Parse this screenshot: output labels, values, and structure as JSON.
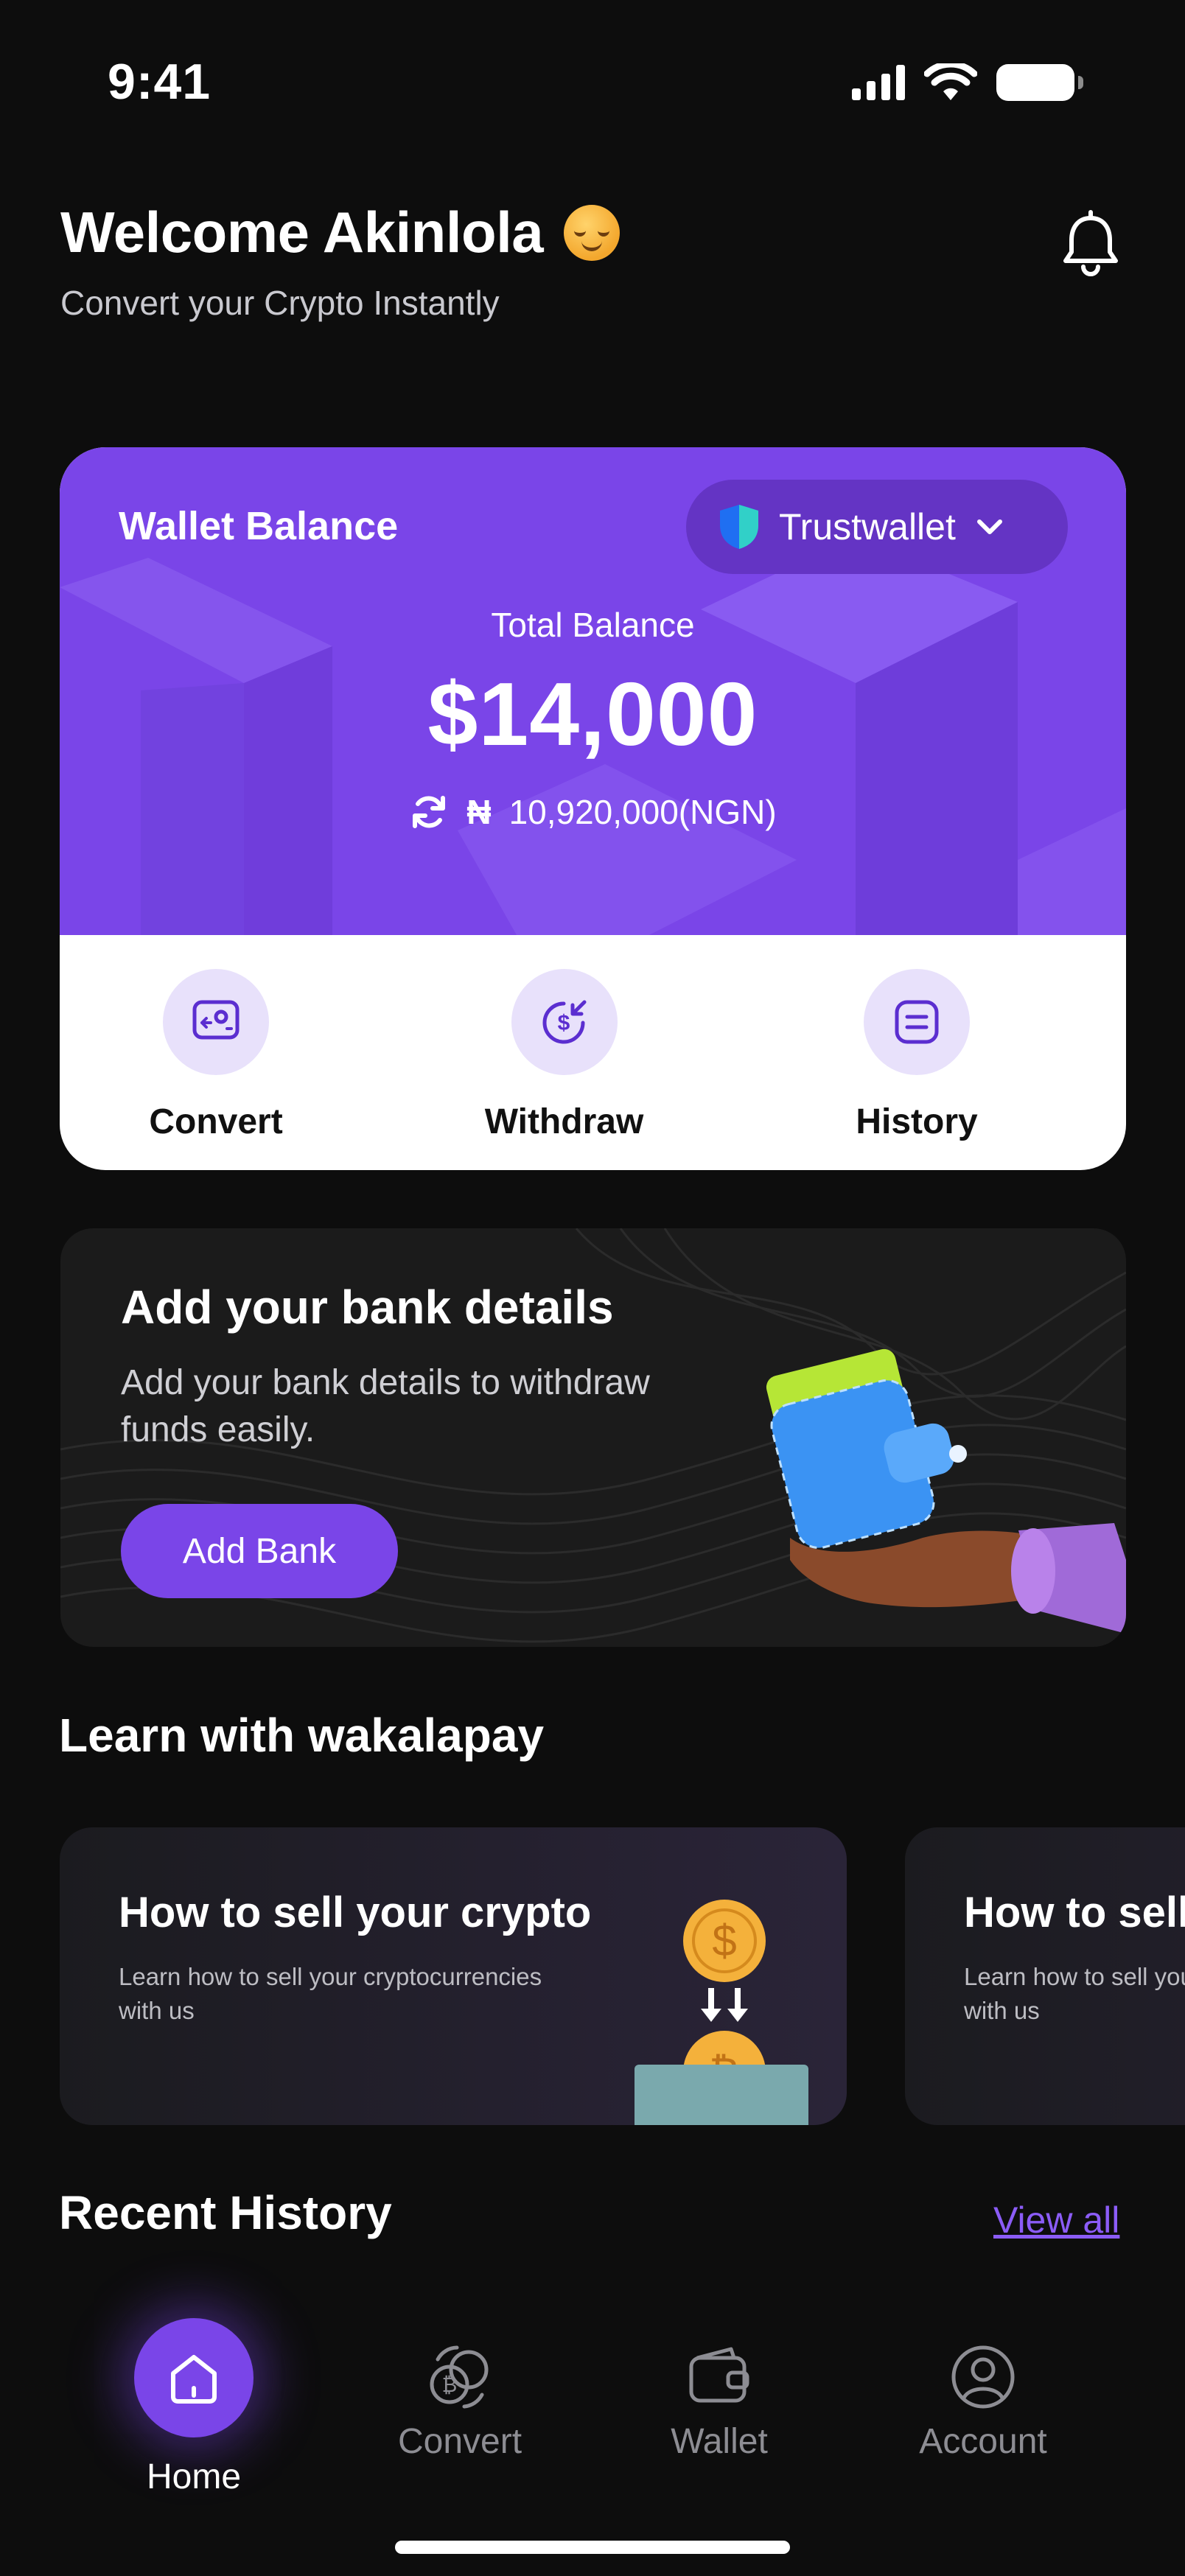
{
  "status_bar": {
    "time": "9:41"
  },
  "header": {
    "welcome": "Welcome Akinlola",
    "subtitle": "Convert your Crypto Instantly"
  },
  "wallet": {
    "title": "Wallet Balance",
    "provider": "Trustwallet",
    "total_label": "Total Balance",
    "total_amount": "$14,000",
    "currency_symbol": "₦",
    "ngn_amount": "10,920,000(NGN)",
    "actions": [
      {
        "label": "Convert",
        "icon": "convert-icon"
      },
      {
        "label": "Withdraw",
        "icon": "withdraw-icon"
      },
      {
        "label": "History",
        "icon": "history-icon"
      }
    ]
  },
  "bank": {
    "title": "Add your bank details",
    "description": "Add your bank details to withdraw funds easily.",
    "button": "Add Bank"
  },
  "learn": {
    "section_title": "Learn with wakalapay",
    "cards": [
      {
        "title": "How to sell your crypto",
        "description": "Learn how to sell your cryptocurrencies with us"
      },
      {
        "title": "How to sell your crypto",
        "description": "Learn how to sell your cryptocurrencies with us"
      }
    ]
  },
  "recent": {
    "title": "Recent History",
    "view_all": "View all"
  },
  "nav": {
    "items": [
      {
        "label": "Home",
        "icon": "home-icon",
        "active": true
      },
      {
        "label": "Convert",
        "icon": "convert-coins-icon",
        "active": false
      },
      {
        "label": "Wallet",
        "icon": "wallet-icon",
        "active": false
      },
      {
        "label": "Account",
        "icon": "account-icon",
        "active": false
      }
    ]
  },
  "colors": {
    "accent": "#7a45e8",
    "background": "#0d0d0d",
    "link": "#8b5cf6"
  }
}
